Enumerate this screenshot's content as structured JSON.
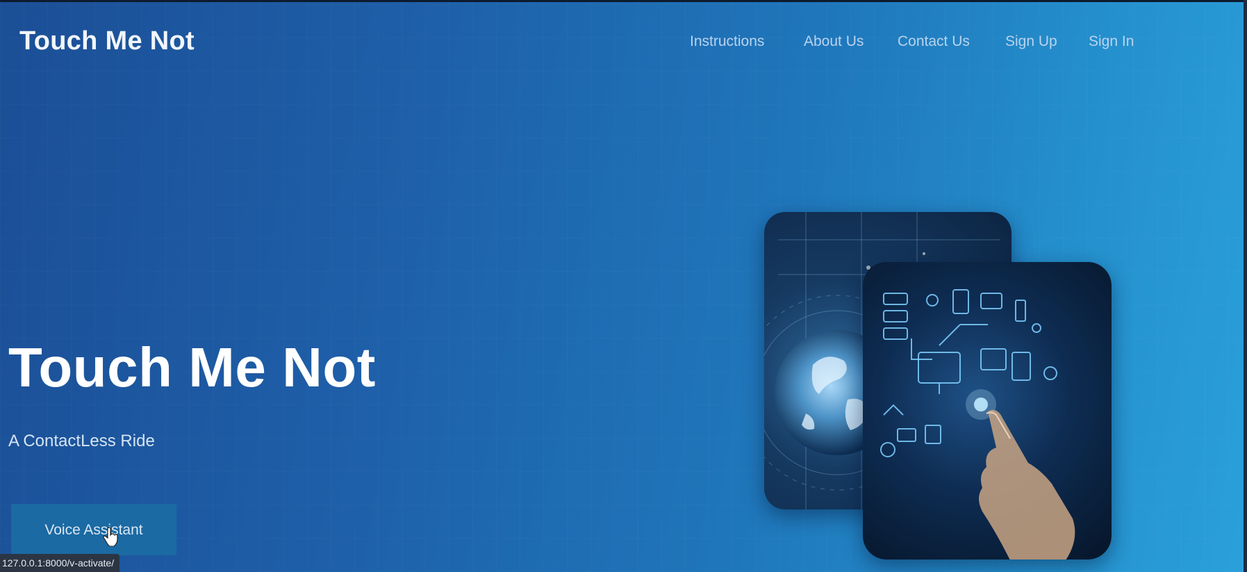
{
  "brand": {
    "name": "Touch Me Not"
  },
  "nav": {
    "items": [
      {
        "label": "Instructions"
      },
      {
        "label": "About Us"
      },
      {
        "label": "Contact Us"
      },
      {
        "label": "Sign Up"
      },
      {
        "label": "Sign In"
      }
    ]
  },
  "hero": {
    "title": "Touch Me Not",
    "subtitle": "A ContactLess Ride",
    "button_label": "Voice Assistant",
    "images": {
      "back": "globe-technology-image",
      "front": "touchscreen-hand-image"
    }
  },
  "status_bar": {
    "url": "127.0.0.1:8000/v-activate/"
  },
  "colors": {
    "gradient_start": "#1b4f96",
    "gradient_end": "#2aa0da",
    "button_bg": "#1b6aa3",
    "nav_text": "#b9d3ee",
    "title_text": "#ffffff"
  }
}
